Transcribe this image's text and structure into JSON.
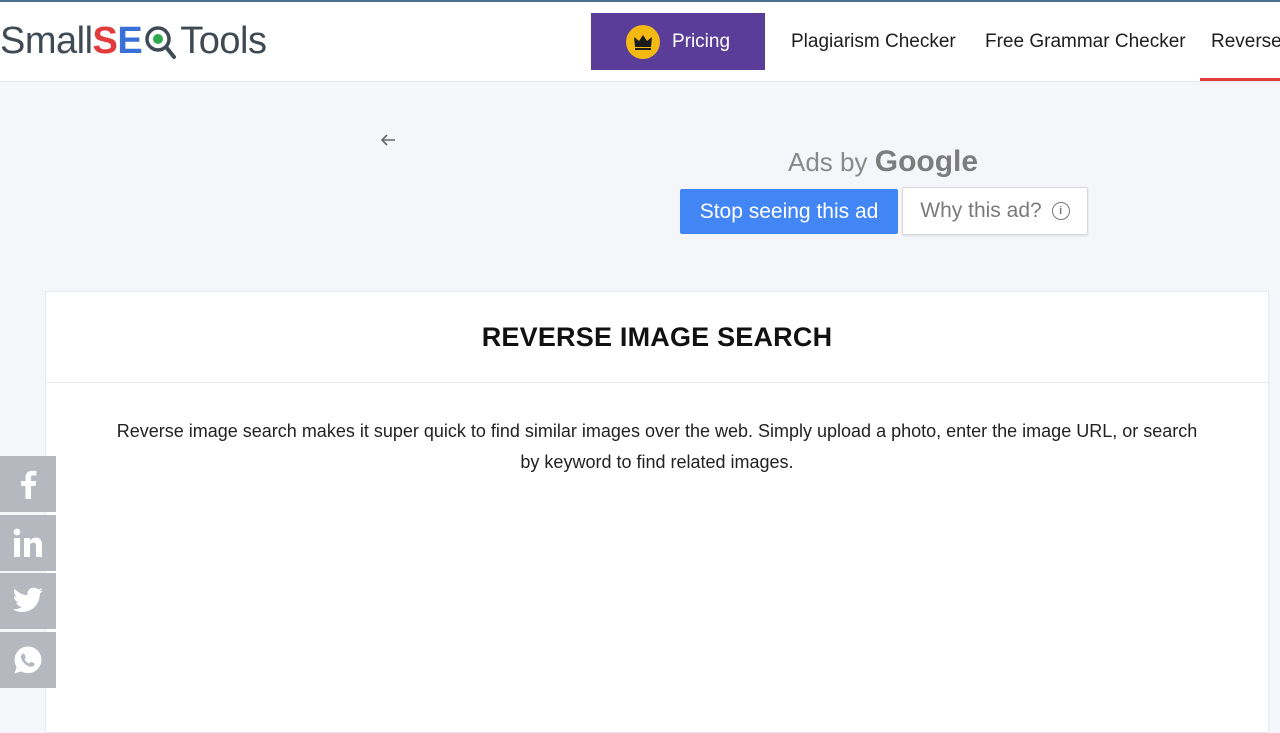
{
  "header": {
    "logo": {
      "part1": "Small",
      "part2_a": "S",
      "part2_b": "E",
      "part3": "Tools"
    },
    "pricing_label": "Pricing",
    "nav": [
      {
        "label": "Plagiarism Checker"
      },
      {
        "label": "Free Grammar Checker"
      },
      {
        "label": "Reverse"
      }
    ]
  },
  "ad": {
    "ads_by": "Ads by",
    "google": "Google",
    "stop_label": "Stop seeing this ad",
    "why_label": "Why this ad?",
    "back_icon": "arrow-left-icon",
    "info_icon": "info-icon"
  },
  "main": {
    "title": "REVERSE IMAGE SEARCH",
    "description": "Reverse image search makes it super quick to find similar images over the web. Simply upload a photo, enter the image URL, or search by keyword to find related images."
  },
  "social": [
    {
      "icon": "facebook-icon"
    },
    {
      "icon": "linkedin-icon"
    },
    {
      "icon": "twitter-icon"
    },
    {
      "icon": "whatsapp-icon"
    }
  ],
  "colors": {
    "pricing_bg": "#5a3d99",
    "crown": "#f5b914",
    "accent_red": "#e23b3b",
    "google_blue": "#4285f4",
    "social_bg": "#b5b8be"
  }
}
